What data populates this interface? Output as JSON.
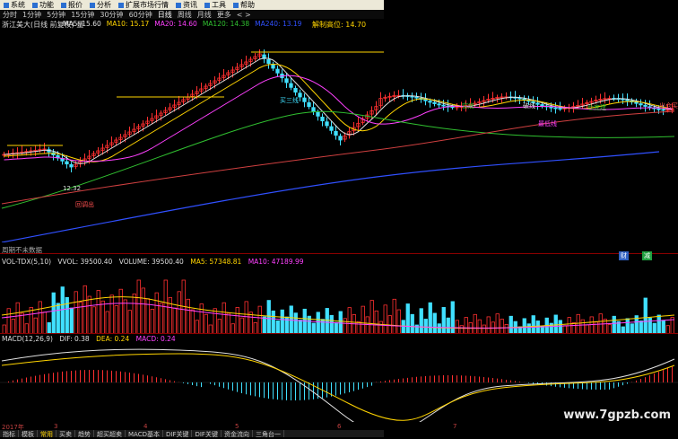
{
  "menubar": {
    "items": [
      "系统",
      "功能",
      "报价",
      "分析",
      "扩展市场行情",
      "资讯",
      "工具",
      "帮助"
    ]
  },
  "timeframes": {
    "items": [
      "分时",
      "1分钟",
      "5分钟",
      "15分钟",
      "30分钟",
      "60分钟",
      "日线",
      "周线",
      "月线",
      "更多"
    ],
    "active_index": 6,
    "arrows": "< >"
  },
  "title": {
    "stock": "浙江美大(日线 前复权) 量"
  },
  "ma_legend": [
    {
      "label": "MA5: 15.60",
      "color": "#e0e0e0"
    },
    {
      "label": "MA10: 15.17",
      "color": "#ffd400"
    },
    {
      "label": "MA20: 14.60",
      "color": "#ff40ff"
    },
    {
      "label": "MA120: 14.38",
      "color": "#30c030"
    },
    {
      "label": "MA240: 13.19",
      "color": "#3050ff"
    }
  ],
  "price_note": "解制高位: 14.70",
  "chart_labels": {
    "low_price": "12.32",
    "tag_buy": "买三线",
    "tag_huiliang": "回调出",
    "tag_low": "空底",
    "tag_mid": "破线",
    "tag_bottom": "最低线",
    "tag_right": "出仓买",
    "tag_blue": "仓底建",
    "no_future": "周期不未数据"
  },
  "badges": {
    "b1": "财",
    "b2": "减"
  },
  "volume": {
    "name": "VOL-TDX(5,10)",
    "vvol": "VVOL: 39500.40",
    "volume": "VOLUME: 39500.40",
    "ma5": "MA5: 57348.81",
    "ma10": "MA10: 47189.99"
  },
  "macd": {
    "name": "MACD(12,26,9)",
    "dif": "DIF: 0.38",
    "dea": "DEA: 0.24",
    "macd": "MACD: 0.24"
  },
  "dates": [
    {
      "label": "2017年",
      "color": "#c04040"
    },
    {
      "label": "3",
      "color": "#c04040"
    },
    {
      "label": "4",
      "color": "#c04040"
    },
    {
      "label": "5",
      "color": "#c04040"
    },
    {
      "label": "6",
      "color": "#c04040"
    },
    {
      "label": "7",
      "color": "#c04040"
    }
  ],
  "bottom_tabs": {
    "items": [
      "指标",
      "模板",
      "常用",
      "买卖",
      "趋势",
      "超买超卖",
      "MACD基本",
      "DIF关键",
      "DIF关键",
      "资金流向",
      "三角台一"
    ],
    "active_index": 2
  },
  "watermark": "www.7gpzb.com",
  "colors": {
    "up": "#ff3030",
    "down": "#40e0ff",
    "ma5": "#e0e0e0",
    "ma10": "#ffd400",
    "ma20": "#ff40ff",
    "ma120": "#30c030",
    "ma240": "#3050ff"
  }
}
